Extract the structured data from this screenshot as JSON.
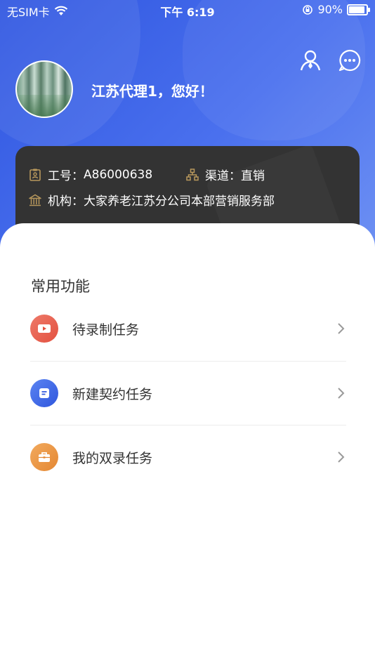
{
  "status_bar": {
    "carrier": "无SIM卡",
    "time": "下午 6:19",
    "battery": "90%",
    "battery_level": 0.9
  },
  "header": {
    "greeting": "江苏代理1，您好！",
    "icons": [
      "user-icon",
      "message-icon"
    ]
  },
  "info_card": {
    "employee_id_label": "工号：",
    "employee_id": "A86000638",
    "channel_label": "渠道：",
    "channel": "直销",
    "org_label": "机构：",
    "org": "大家养老江苏分公司本部营销服务部"
  },
  "functions": {
    "title": "常用功能",
    "items": [
      {
        "label": "待录制任务",
        "icon": "video-icon",
        "color": "#ea5f4f"
      },
      {
        "label": "新建契约任务",
        "icon": "document-icon",
        "color": "#3a66e8"
      },
      {
        "label": "我的双录任务",
        "icon": "briefcase-icon",
        "color": "#ee9a45"
      }
    ]
  },
  "colors": {
    "header_blue": "#3b62e6",
    "card_dark": "#333333",
    "card_icon_gold": "#b8985c"
  }
}
